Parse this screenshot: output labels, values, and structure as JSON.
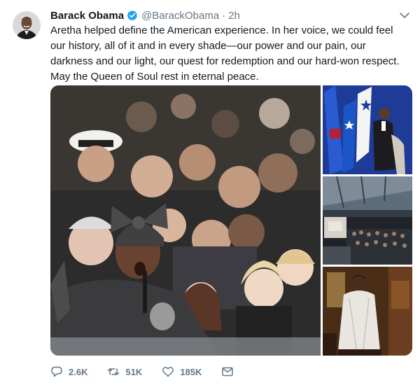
{
  "tweet": {
    "author_name": "Barack Obama",
    "handle": "@BarackObama",
    "separator": "·",
    "timestamp": "2h",
    "text": "Aretha helped define the American experience. In her voice, we could feel our history, all of it and in every shade—our power and our pain, our darkness and our light, our quest for redemption and our hard-won respect. May the Queen of Soul rest in eternal peace."
  },
  "actions": {
    "replies": "2.6K",
    "retweets": "51K",
    "likes": "185K"
  },
  "icons": [
    "avatar",
    "verified-badge-icon",
    "chevron-down-icon",
    "reply-icon",
    "retweet-icon",
    "like-icon",
    "message-icon"
  ],
  "colors": {
    "text": "#14171a",
    "secondary": "#657786",
    "verified": "#1da1f2"
  }
}
